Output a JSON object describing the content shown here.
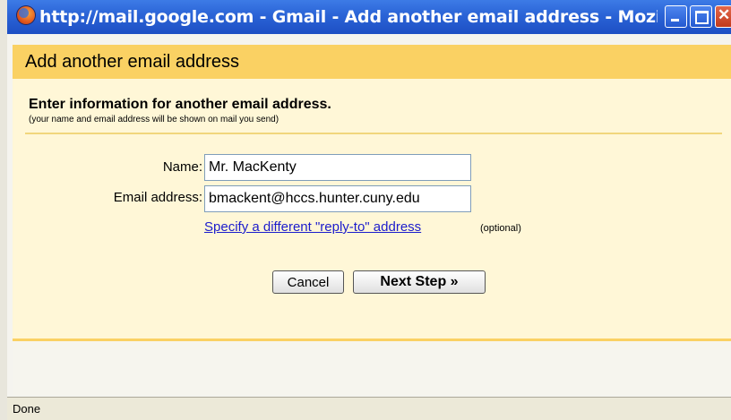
{
  "window": {
    "title": "http://mail.google.com - Gmail - Add another email address - Mozilla Fir..."
  },
  "dialog": {
    "header": "Add another email address",
    "heading": "Enter information for another email address.",
    "subheading": "(your name and email address will be shown on mail you send)",
    "fields": {
      "name_label": "Name:",
      "name_value": "Mr. MacKenty",
      "email_label": "Email address:",
      "email_value": "bmackent@hccs.hunter.cuny.edu"
    },
    "reply_to_link": "Specify a different \"reply-to\" address",
    "optional_note": "(optional)",
    "buttons": {
      "cancel": "Cancel",
      "next": "Next Step »"
    }
  },
  "status": {
    "text": "Done"
  },
  "colors": {
    "titlebar": "#2a63d6",
    "header_band": "#fad163",
    "content_bg": "#fff7d7",
    "link": "#1c1ccc"
  }
}
